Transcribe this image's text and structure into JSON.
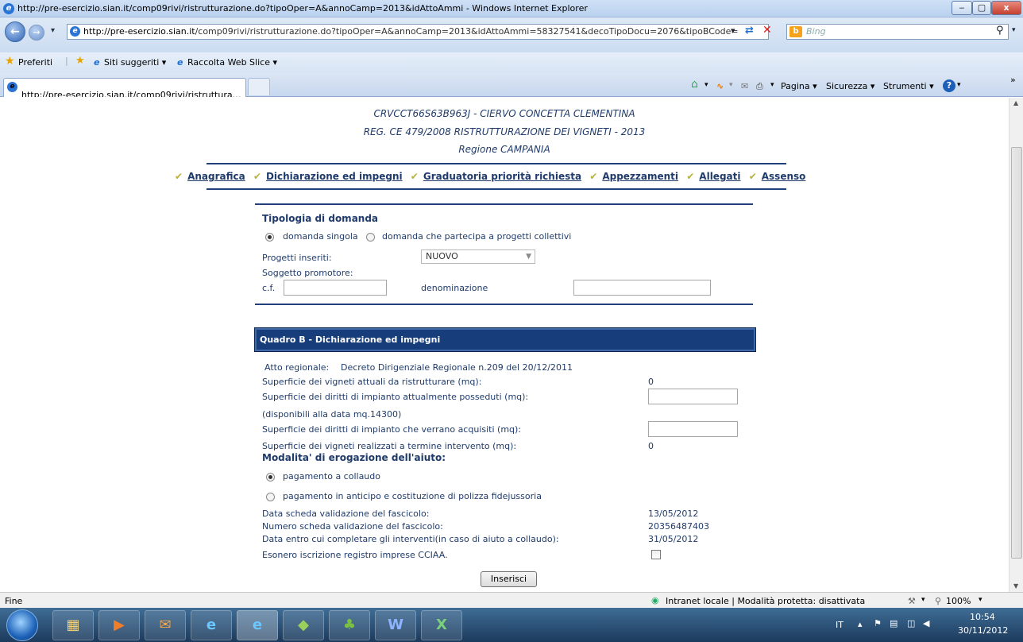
{
  "window": {
    "title": "http://pre-esercizio.sian.it/comp09rivi/ristrutturazione.do?tipoOper=A&annoCamp=2013&idAttoAmmi - Windows Internet Explorer",
    "min": "‒",
    "max": "▢",
    "close": "x"
  },
  "address": {
    "url_host": "http://pre-esercizio.sian.it",
    "url_path": "/comp09rivi/ristrutturazione.do?tipoOper=A&annoCamp=2013&idAttoAmmi=58327541&decoTipoDocu=2076&tipoBCode=",
    "search_placeholder": "Bing"
  },
  "favorites": {
    "preferiti": "Preferiti",
    "siti": "Siti suggeriti ▾",
    "raccolta": "Raccolta Web Slice ▾"
  },
  "tab": {
    "label": "http://pre-esercizio.sian.it/comp09rivi/ristruttura..."
  },
  "commandbar": {
    "pagina": "Pagina ▾",
    "sicurezza": "Sicurezza ▾",
    "strumenti": "Strumenti ▾",
    "chev": "»"
  },
  "header": {
    "line1": "CRVCCT66S63B963J - CIERVO CONCETTA CLEMENTINA",
    "line2": "REG. CE 479/2008 RISTRUTTURAZIONE DEI VIGNETI - 2013",
    "line3": "Regione CAMPANIA"
  },
  "nav": {
    "items": [
      "Anagrafica",
      "Dichiarazione ed impegni",
      "Graduatoria priorità richiesta",
      "Appezzamenti",
      "Allegati",
      "Assenso"
    ]
  },
  "tipologia": {
    "title": "Tipologia di domanda",
    "opt1": "domanda singola",
    "opt2": "domanda che partecipa a progetti collettivi",
    "progetti_label": "Progetti inseriti:",
    "progetti_value": "NUOVO",
    "soggetto_label": "Soggetto promotore:",
    "cf_label": "c.f.",
    "denominazione_label": "denominazione"
  },
  "quadro": {
    "title": "Quadro B - Dichiarazione ed impegni",
    "atto_label": "Atto regionale:",
    "atto_value": "Decreto Dirigenziale Regionale n.209 del 20/12/2011",
    "sup1_label": "Superficie dei vigneti attuali da ristrutturare (mq):",
    "sup1_value": "0",
    "sup2_label": "Superficie dei diritti di impianto attualmente posseduti (mq):",
    "disponibili": "(disponibili alla data mq.14300)",
    "sup3_label": "Superficie dei diritti di impianto che verrano acquisiti (mq):",
    "sup4_label": "Superficie dei vigneti realizzati a termine intervento (mq):",
    "sup4_value": "0",
    "modalita_title": "Modalita' di erogazione dell'aiuto:",
    "pag1": "pagamento a collaudo",
    "pag2": "pagamento in anticipo e costituzione di polizza fidejussoria",
    "data_label": "Data scheda validazione del fascicolo:",
    "data_value": "13/05/2012",
    "numero_label": "Numero scheda validazione del fascicolo:",
    "numero_value": "20356487403",
    "entro_label": "Data entro cui completare gli interventi(in caso di aiuto a collaudo):",
    "entro_value": "31/05/2012",
    "esonero_label": "Esonero iscrizione registro imprese CCIAA.",
    "submit": "Inserisci"
  },
  "status": {
    "left": "Fine",
    "zone": "Intranet locale | Modalità protetta: disattivata",
    "zoom": "100%"
  },
  "taskbar": {
    "lang": "IT",
    "time": "10:54",
    "date": "30/11/2012"
  }
}
